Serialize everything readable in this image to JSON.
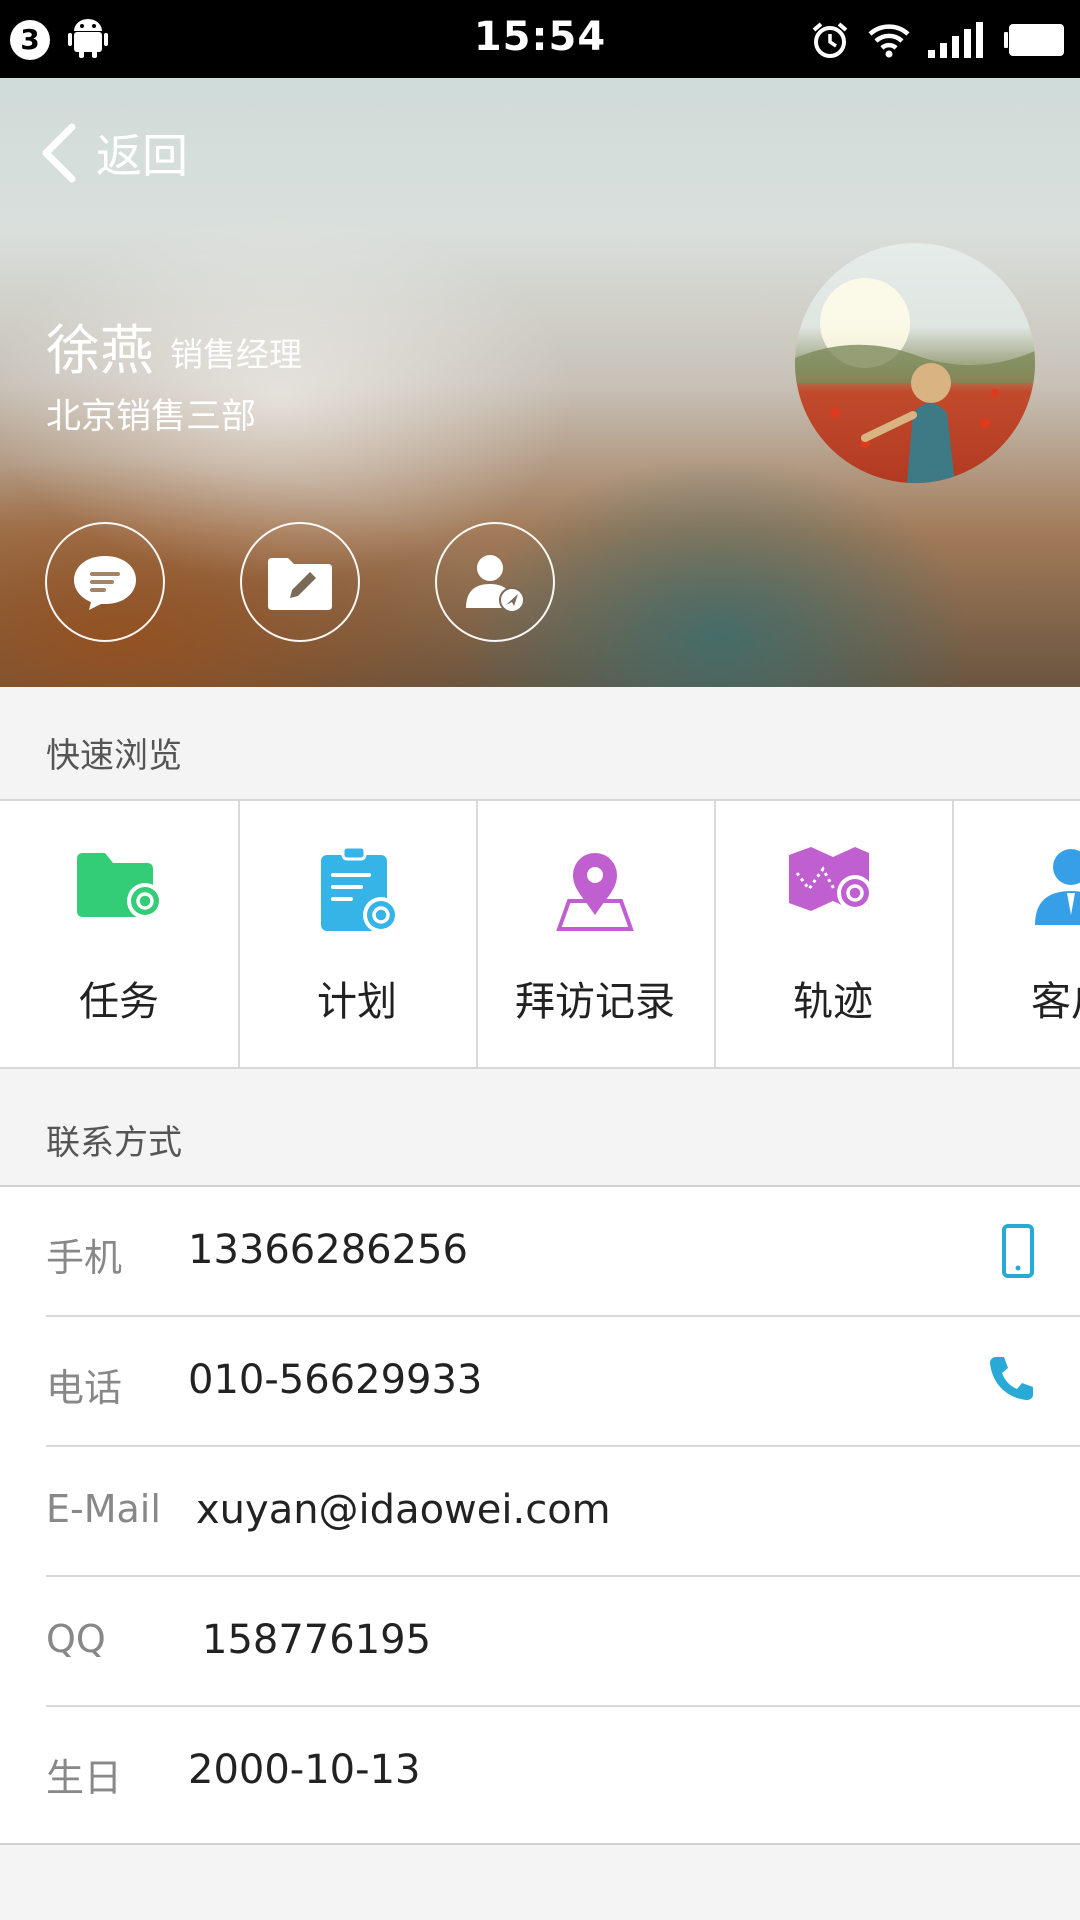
{
  "status_bar": {
    "notification_count": "3",
    "time": "15:54"
  },
  "header": {
    "back_label": "返回",
    "name": "徐燕",
    "role": "销售经理",
    "department": "北京销售三部"
  },
  "action_buttons": [
    "message-icon",
    "folder-edit-icon",
    "contact-locate-icon"
  ],
  "quick_browse": {
    "title": "快速浏览",
    "items": [
      {
        "label": "任务",
        "icon": "task-folder-icon",
        "color": "#33cc77"
      },
      {
        "label": "计划",
        "icon": "plan-clipboard-icon",
        "color": "#35b4e8"
      },
      {
        "label": "拜访记录",
        "icon": "visit-location-icon",
        "color": "#c060d0"
      },
      {
        "label": "轨迹",
        "icon": "track-map-icon",
        "color": "#c060d0"
      },
      {
        "label": "客户",
        "icon": "customer-icon",
        "color": "#35a0e8"
      }
    ]
  },
  "contact": {
    "title": "联系方式",
    "rows": [
      {
        "label": "手机",
        "value": "13366286256",
        "action_icon": "mobile-phone-icon"
      },
      {
        "label": "电话",
        "value": "010-56629933",
        "action_icon": "phone-icon"
      },
      {
        "label": "E-Mail",
        "value": "xuyan@idaowei.com"
      },
      {
        "label": "QQ",
        "value": "158776195"
      },
      {
        "label": "生日",
        "value": "2000-10-13"
      }
    ]
  },
  "colors": {
    "accent": "#29a9d6",
    "page_background": "#f4f4f4"
  }
}
